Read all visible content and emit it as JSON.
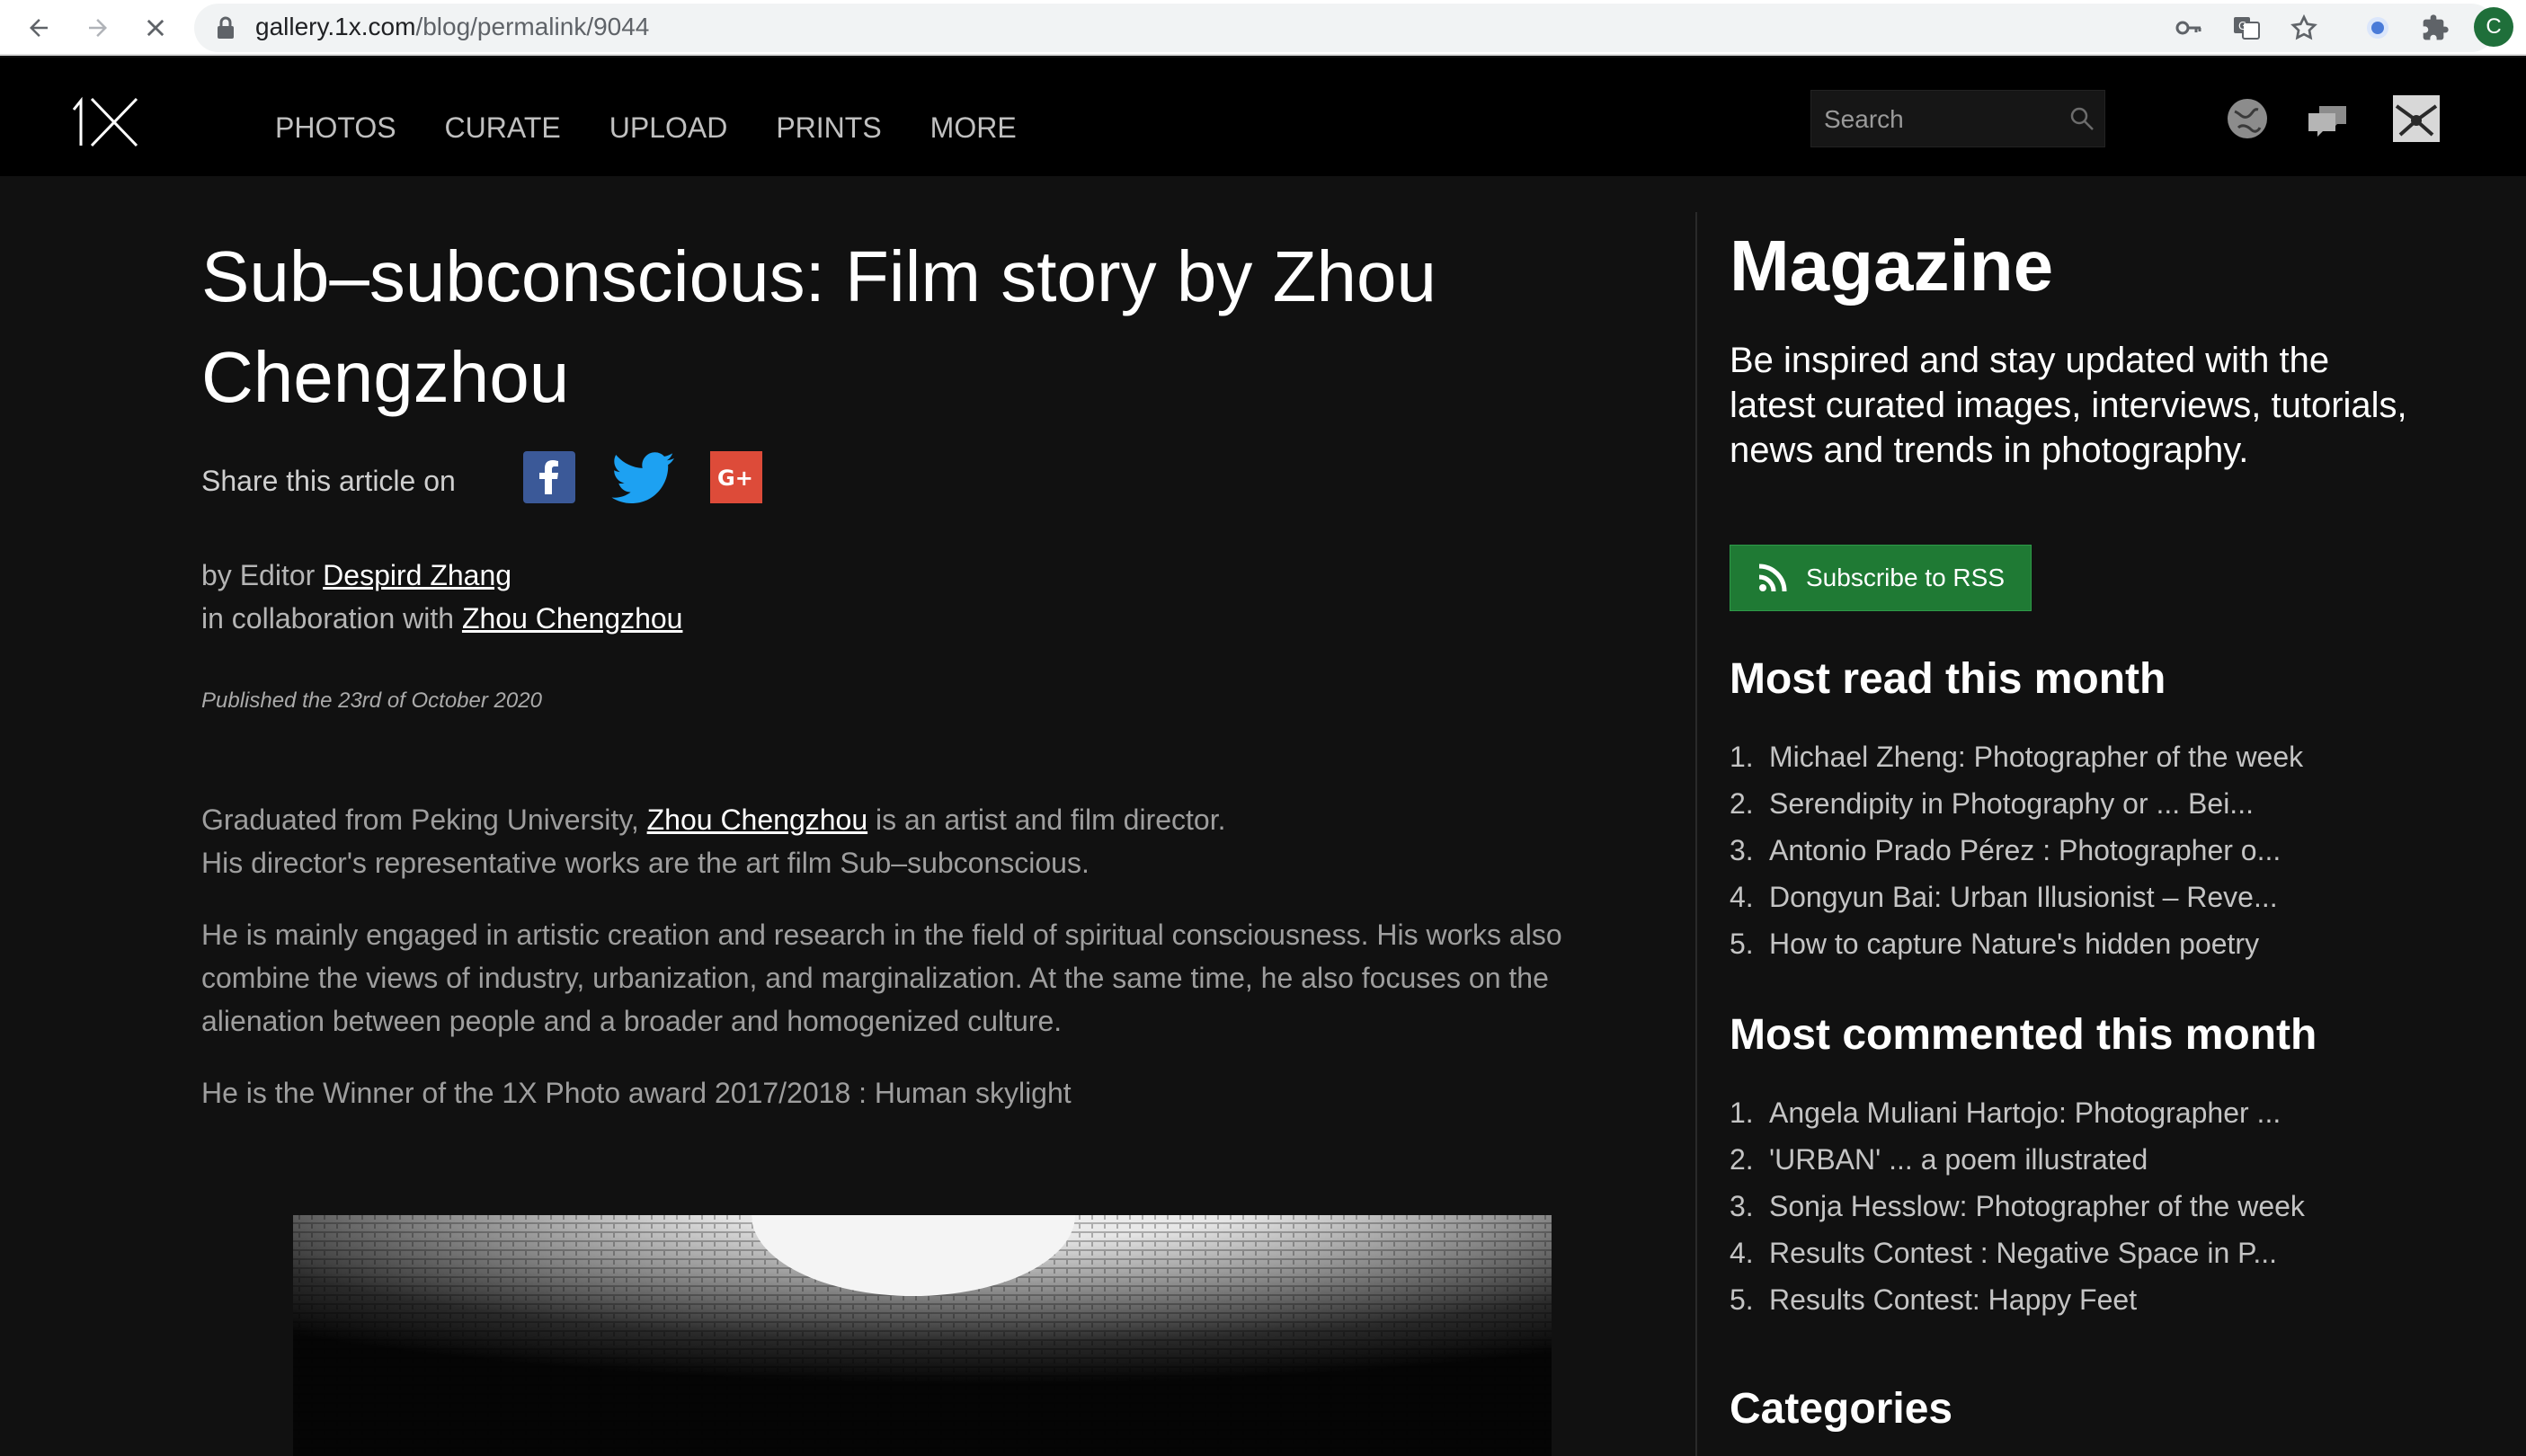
{
  "browser": {
    "url_domain": "gallery.1x.com",
    "url_path": "/blog/permalink/9044",
    "profile_initial": "C"
  },
  "site": {
    "nav": [
      "PHOTOS",
      "CURATE",
      "UPLOAD",
      "PRINTS",
      "MORE"
    ],
    "search_placeholder": "Search"
  },
  "article": {
    "title": "Sub–subconscious: Film story by Zhou Chengzhou",
    "share_label": "Share this article on",
    "by_prefix": "by Editor",
    "editor": "Despird Zhang",
    "collab_prefix": "in collaboration with",
    "collaborator": "Zhou Chengzhou",
    "published": "Published the  23rd  of October 2020",
    "p1_prefix": "Graduated from Peking University,",
    "p1_link": "Zhou Chengzhou",
    "p1_suffix": "is an artist and film director.",
    "p1_line2": "His director's representative works are the art film Sub–subconscious.",
    "p2": "He is mainly engaged in artistic creation and research in the field of spiritual consciousness. His works also combine the views of industry, urbanization, and marginalization. At the same time, he also focuses on the alienation between people and a broader and homogenized culture.",
    "p3": "He is the Winner of the 1X Photo award 2017/2018 : Human skylight"
  },
  "sidebar": {
    "title": "Magazine",
    "description": "Be inspired and stay updated with the latest curated images, interviews, tutorials, news and trends in photography.",
    "rss_label": "Subscribe to RSS",
    "most_read_heading": "Most read this month",
    "most_read": [
      {
        "num": "1.",
        "label": "Michael Zheng: Photographer of the week"
      },
      {
        "num": "2.",
        "label": "Serendipity in Photography or ... Bei..."
      },
      {
        "num": "3.",
        "label": "Antonio Prado Pérez : Photographer o..."
      },
      {
        "num": "4.",
        "label": "Dongyun Bai: Urban Illusionist – Reve..."
      },
      {
        "num": "5.",
        "label": "How to capture Nature's hidden poetry"
      }
    ],
    "most_commented_heading": "Most commented this month",
    "most_commented": [
      {
        "num": "1.",
        "label": "Angela Muliani Hartojo: Photographer ..."
      },
      {
        "num": "2.",
        "label": "'URBAN' ... a poem illustrated"
      },
      {
        "num": "3.",
        "label": "Sonja Hesslow: Photographer of the week"
      },
      {
        "num": "4.",
        "label": "Results Contest : Negative Space in P..."
      },
      {
        "num": "5.",
        "label": "Results Contest: Happy Feet"
      }
    ],
    "categories_heading": "Categories"
  },
  "colors": {
    "background": "#111111",
    "header": "#000000",
    "rss_green": "#1f7a34",
    "facebook": "#3b5998",
    "twitter": "#1da1f2",
    "googleplus": "#dd4b39"
  }
}
